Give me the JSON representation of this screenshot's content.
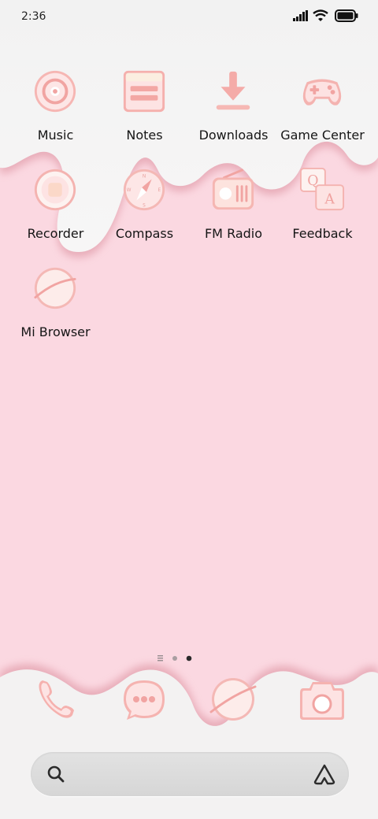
{
  "status_bar": {
    "time": "2:36"
  },
  "apps": [
    {
      "id": "music",
      "label": "Music",
      "icon": "music-disc-icon"
    },
    {
      "id": "notes",
      "label": "Notes",
      "icon": "notes-icon"
    },
    {
      "id": "downloads",
      "label": "Downloads",
      "icon": "download-icon"
    },
    {
      "id": "game-center",
      "label": "Game Center",
      "icon": "gamepad-icon"
    },
    {
      "id": "recorder",
      "label": "Recorder",
      "icon": "recorder-icon"
    },
    {
      "id": "compass",
      "label": "Compass",
      "icon": "compass-icon"
    },
    {
      "id": "fm-radio",
      "label": "FM Radio",
      "icon": "radio-icon"
    },
    {
      "id": "feedback",
      "label": "Feedback",
      "icon": "qa-feedback-icon"
    },
    {
      "id": "mi-browser",
      "label": "Mi Browser",
      "icon": "planet-icon"
    }
  ],
  "page_indicator": {
    "pages": 2,
    "current": 2
  },
  "dock": [
    {
      "id": "phone",
      "icon": "phone-icon"
    },
    {
      "id": "messages",
      "icon": "message-bubble-icon"
    },
    {
      "id": "browser",
      "icon": "planet-icon"
    },
    {
      "id": "camera",
      "icon": "camera-icon"
    }
  ],
  "theme": {
    "background": "#fbd8e1",
    "frost": "#f3f2f2",
    "icon_base": "#fde4e6",
    "icon_accent": "#f3a9a9"
  }
}
